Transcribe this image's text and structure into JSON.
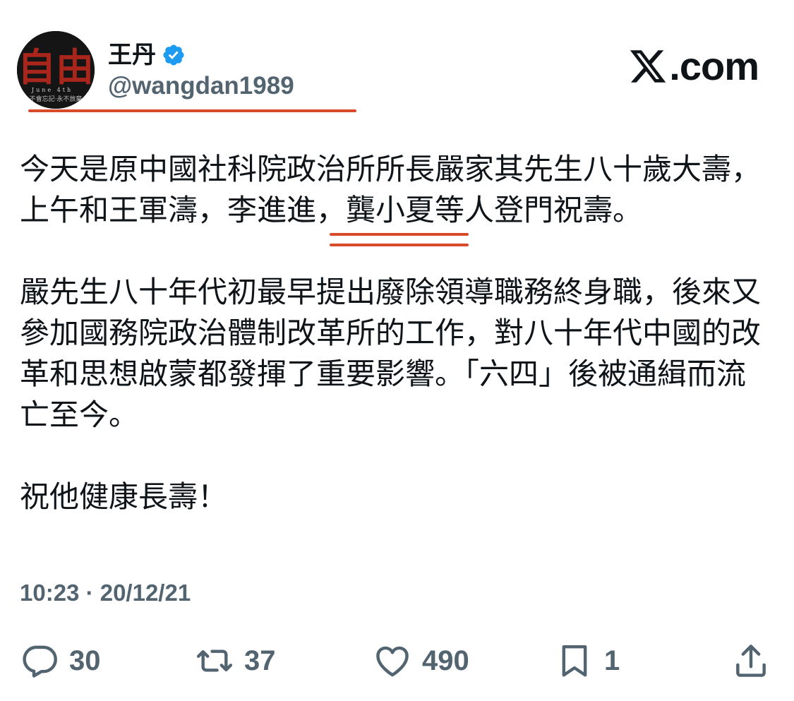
{
  "brand": {
    "label": ".com",
    "icon": "x-logo-icon"
  },
  "author": {
    "display_name": "王丹",
    "handle": "@wangdan1989",
    "verified": true,
    "avatar": {
      "big_text": "自由",
      "line1": "June 4th",
      "line2": "不會忘記·永不放棄"
    }
  },
  "tweet": {
    "paragraphs": [
      [
        "今天是原中國社科院政治所所長嚴家其先生八十歲大壽，",
        "上午和王軍濤，李進進，龔小夏等人登門祝壽。"
      ],
      [
        "嚴先生八十年代初最早提出廢除領導職務終身職，後來又",
        "參加國務院政治體制改革所的工作，對八十年代中國的改",
        "革和思想啟蒙都發揮了重要影響。「六四」後被通緝而流",
        "亡至今。"
      ],
      [
        "祝他健康長壽！"
      ]
    ],
    "timestamp": "10:23 · 20/12/21"
  },
  "actions": {
    "reply": {
      "icon": "reply-icon",
      "count": "30"
    },
    "retweet": {
      "icon": "retweet-icon",
      "count": "37"
    },
    "like": {
      "icon": "heart-icon",
      "count": "490"
    },
    "bookmark": {
      "icon": "bookmark-icon",
      "count": "1"
    },
    "share": {
      "icon": "share-icon"
    }
  },
  "colors": {
    "text": "#0f1419",
    "secondary": "#536471",
    "verified": "#1d9bf0",
    "annotation_underline": "#d94a2b",
    "avatar_red": "#b8281c"
  }
}
